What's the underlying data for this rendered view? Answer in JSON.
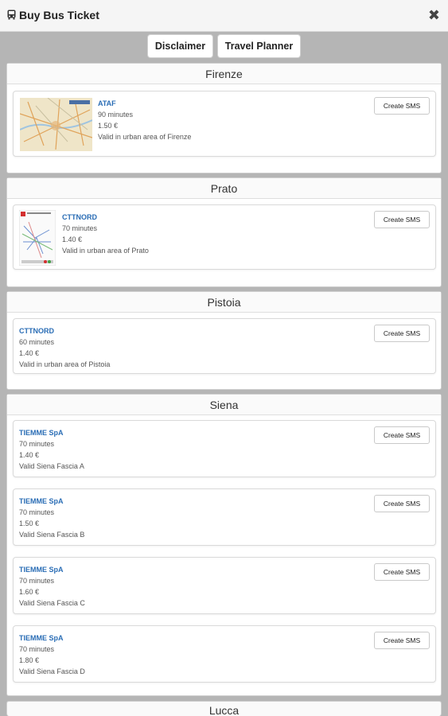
{
  "app": {
    "title": "Buy Bus Ticket",
    "close_symbol": "✖"
  },
  "toolbar": {
    "disclaimer_label": "Disclaimer",
    "planner_label": "Travel Planner"
  },
  "sms_label": "Create SMS",
  "sections": [
    {
      "city": "Firenze",
      "tickets": [
        {
          "operator": "ATAF",
          "duration": "90 minutes",
          "price": "1.50 €",
          "validity": "Valid in urban area of Firenze"
        }
      ]
    },
    {
      "city": "Prato",
      "tickets": [
        {
          "operator": "CTTNORD",
          "duration": "70 minutes",
          "price": "1.40 €",
          "validity": "Valid in urban area of Prato"
        }
      ]
    },
    {
      "city": "Pistoia",
      "tickets": [
        {
          "operator": "CTTNORD",
          "duration": "60 minutes",
          "price": "1.40 €",
          "validity": "Valid in urban area of Pistoia"
        }
      ]
    },
    {
      "city": "Siena",
      "tickets": [
        {
          "operator": "TIEMME SpA",
          "duration": "70 minutes",
          "price": "1.40 €",
          "validity": "Valid Siena Fascia A"
        },
        {
          "operator": "TIEMME SpA",
          "duration": "70 minutes",
          "price": "1.50 €",
          "validity": "Valid Siena Fascia B"
        },
        {
          "operator": "TIEMME SpA",
          "duration": "70 minutes",
          "price": "1.60 €",
          "validity": "Valid Siena Fascia C"
        },
        {
          "operator": "TIEMME SpA",
          "duration": "70 minutes",
          "price": "1.80 €",
          "validity": "Valid Siena Fascia D"
        }
      ]
    },
    {
      "city": "Lucca",
      "tickets": []
    }
  ],
  "icons": {
    "bus": "bus-icon",
    "close": "close-icon",
    "map": "map-thumbnail",
    "diagram": "network-map-thumbnail"
  },
  "colors": {
    "operator_link": "#2a6db5",
    "background": "#b5b5b5"
  }
}
